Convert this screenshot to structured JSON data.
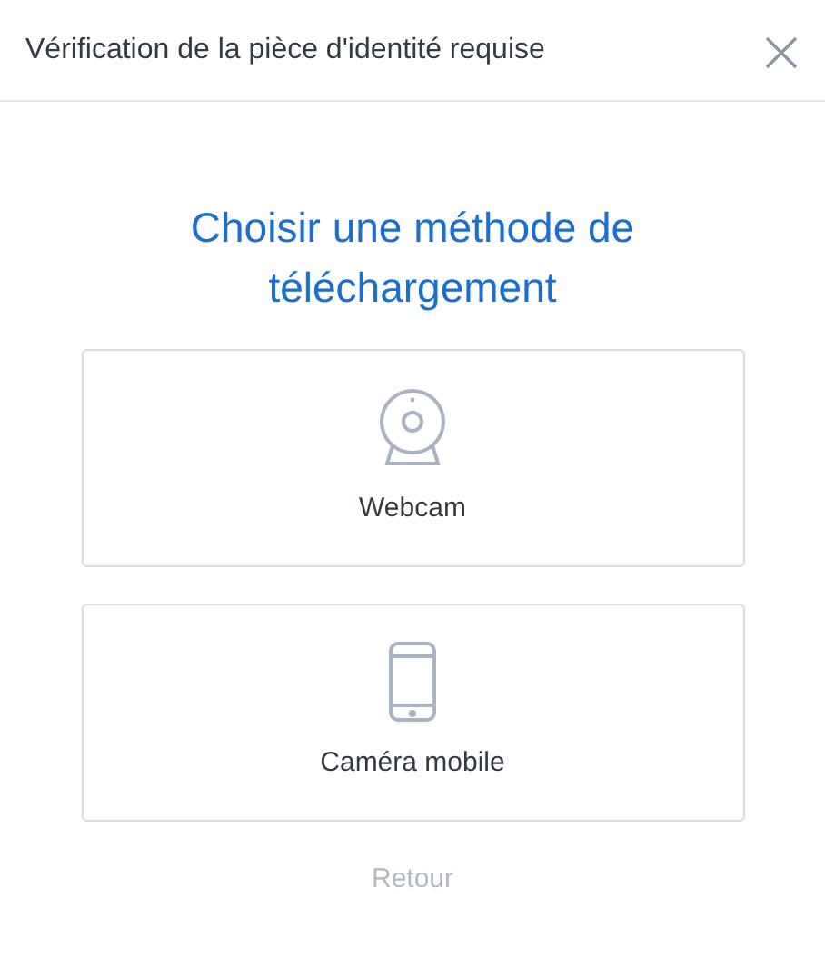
{
  "dialog": {
    "title": "Vérification de la pièce d'identité requise"
  },
  "heading": "Choisir une méthode de téléchargement",
  "options": [
    {
      "kind": "webcam",
      "label": "Webcam"
    },
    {
      "kind": "mobile",
      "label": "Caméra mobile"
    }
  ],
  "back_link": "Retour"
}
